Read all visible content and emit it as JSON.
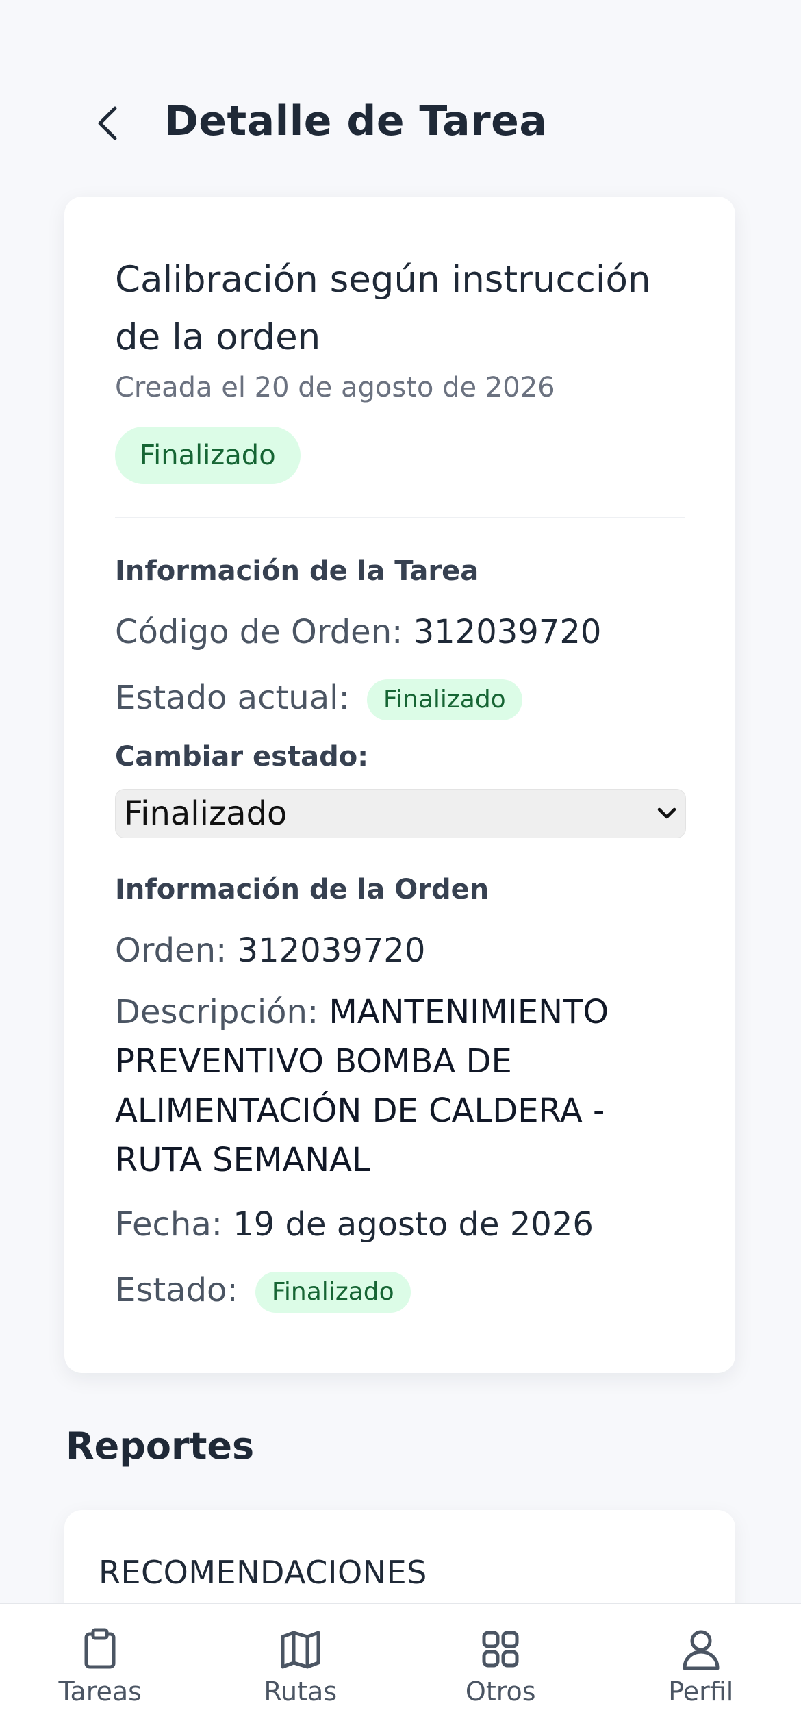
{
  "header": {
    "title": "Detalle de Tarea"
  },
  "task": {
    "title": "Calibración según instrucción de la orden",
    "created": "Creada el 20 de agosto de 2026",
    "status_badge": "Finalizado"
  },
  "task_info": {
    "section_label": "Información de la Tarea",
    "order_code_label": "Código de Orden:",
    "order_code_value": "312039720",
    "current_status_label": "Estado actual:",
    "current_status_value": "Finalizado",
    "change_status_label": "Cambiar estado:",
    "change_status_selected": "Finalizado"
  },
  "order_info": {
    "section_label": "Información de la Orden",
    "order_label": "Orden:",
    "order_value": "312039720",
    "description_label": "Descripción:",
    "description_value": "MANTENIMIENTO PREVENTIVO BOMBA DE ALIMENTACIÓN DE CALDERA - RUTA SEMANAL",
    "date_label": "Fecha:",
    "date_value": "19 de agosto de 2026",
    "status_label": "Estado:",
    "status_value": "Finalizado"
  },
  "reports": {
    "title": "Reportes",
    "first_card_title": "RECOMENDACIONES"
  },
  "tabbar": {
    "items": [
      {
        "label": "Tareas",
        "icon": "clipboard-icon"
      },
      {
        "label": "Rutas",
        "icon": "map-icon"
      },
      {
        "label": "Otros",
        "icon": "grid-icon"
      },
      {
        "label": "Perfil",
        "icon": "user-icon"
      }
    ]
  },
  "colors": {
    "badge_bg": "#dcfce7",
    "badge_text": "#166534",
    "background": "#f7f8fb"
  }
}
